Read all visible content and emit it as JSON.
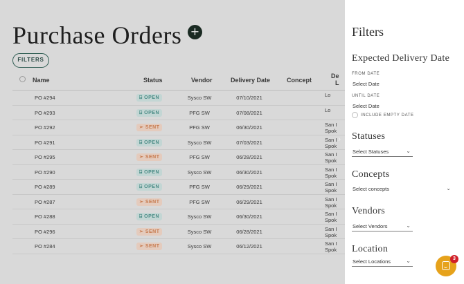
{
  "page": {
    "title": "Purchase Orders",
    "add_icon": "+",
    "filters_button": "FILTERS"
  },
  "table": {
    "headers": {
      "name": "Name",
      "status": "Status",
      "vendor": "Vendor",
      "delivery_date": "Delivery Date",
      "concept": "Concept",
      "location_top": "De",
      "location_bottom": "L"
    },
    "rows": [
      {
        "name": "PO #294",
        "status": "OPEN",
        "status_icon": "open-icon",
        "vendor": "Sysco SW",
        "date": "07/10/2021",
        "loc1": "Lo",
        "loc2": ""
      },
      {
        "name": "PO #293",
        "status": "OPEN",
        "status_icon": "open-icon",
        "vendor": "PFG SW",
        "date": "07/08/2021",
        "loc1": "Lo",
        "loc2": ""
      },
      {
        "name": "PO #292",
        "status": "SENT",
        "status_icon": "send-icon",
        "vendor": "PFG SW",
        "date": "06/30/2021",
        "loc1": "San I",
        "loc2": "Spok"
      },
      {
        "name": "PO #291",
        "status": "OPEN",
        "status_icon": "open-icon",
        "vendor": "Sysco SW",
        "date": "07/03/2021",
        "loc1": "San I",
        "loc2": "Spok"
      },
      {
        "name": "PO #295",
        "status": "SENT",
        "status_icon": "send-icon",
        "vendor": "PFG SW",
        "date": "06/28/2021",
        "loc1": "San I",
        "loc2": "Spok"
      },
      {
        "name": "PO #290",
        "status": "OPEN",
        "status_icon": "open-icon",
        "vendor": "Sysco SW",
        "date": "06/30/2021",
        "loc1": "San I",
        "loc2": "Spok"
      },
      {
        "name": "PO #289",
        "status": "OPEN",
        "status_icon": "open-icon",
        "vendor": "PFG SW",
        "date": "06/29/2021",
        "loc1": "San I",
        "loc2": "Spok"
      },
      {
        "name": "PO #287",
        "status": "SENT",
        "status_icon": "send-icon",
        "vendor": "PFG SW",
        "date": "06/29/2021",
        "loc1": "San I",
        "loc2": "Spok"
      },
      {
        "name": "PO #288",
        "status": "OPEN",
        "status_icon": "open-icon",
        "vendor": "Sysco SW",
        "date": "06/30/2021",
        "loc1": "San I",
        "loc2": "Spok"
      },
      {
        "name": "PO #296",
        "status": "SENT",
        "status_icon": "send-icon",
        "vendor": "Sysco SW",
        "date": "06/28/2021",
        "loc1": "San I",
        "loc2": "Spok"
      },
      {
        "name": "PO #284",
        "status": "SENT",
        "status_icon": "send-icon",
        "vendor": "Sysco SW",
        "date": "06/12/2021",
        "loc1": "San I",
        "loc2": "Spok"
      }
    ]
  },
  "drawer": {
    "title": "Filters",
    "delivery": {
      "title": "Expected Delivery Date",
      "from_label": "FROM DATE",
      "from_value": "Select Date",
      "until_label": "UNTIL DATE",
      "until_value": "Select Date",
      "include_empty": "INCLUDE EMPTY DATE"
    },
    "statuses": {
      "title": "Statuses",
      "value": "Select Statuses"
    },
    "concepts": {
      "title": "Concepts",
      "value": "Select concepts"
    },
    "vendors": {
      "title": "Vendors",
      "value": "Select Vendors"
    },
    "location": {
      "title": "Location",
      "value": "Select Locations"
    }
  },
  "chat": {
    "badge_count": "3"
  },
  "colors": {
    "accent": "#2b5a50",
    "open_badge_bg": "#c3d6d4",
    "open_badge_fg": "#4a8c86",
    "sent_badge_bg": "#e4cbbd",
    "sent_badge_fg": "#c77b4f",
    "chat": "#e6a21b",
    "notification": "#d0202a"
  }
}
